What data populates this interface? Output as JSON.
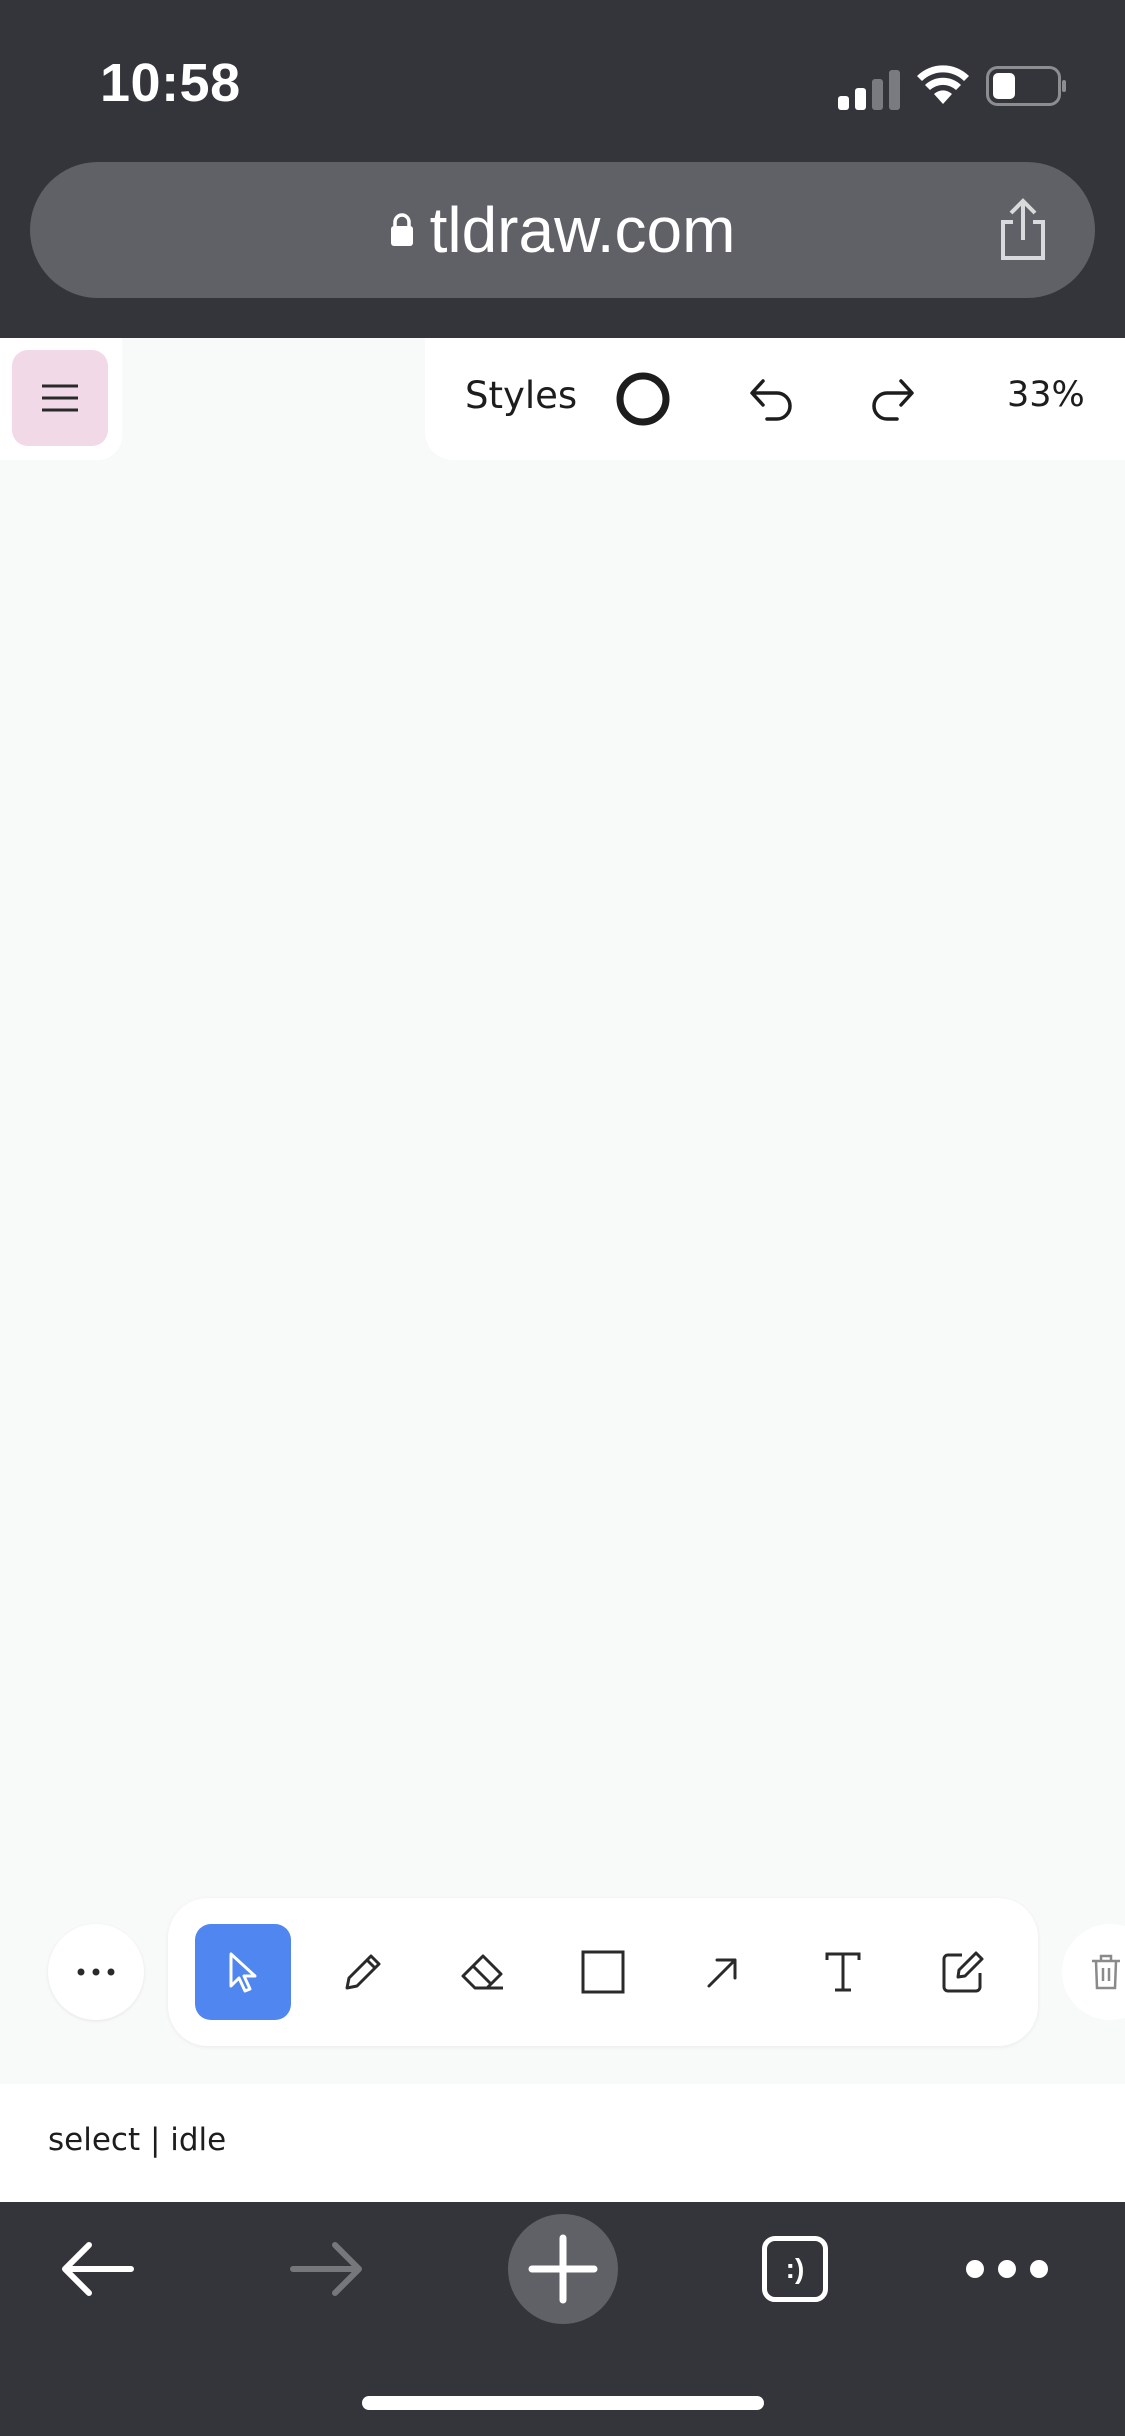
{
  "status_bar": {
    "time": "10:58",
    "icons": [
      "cellular-signal-icon",
      "wifi-icon",
      "battery-icon"
    ]
  },
  "url_bar": {
    "domain": "tldraw.com",
    "icons": [
      "lock-icon",
      "share-icon"
    ]
  },
  "app": {
    "menu_icon": "hamburger-menu-icon",
    "style_panel": {
      "styles_label": "Styles",
      "zoom": "33%",
      "icons": [
        "style-circle-icon",
        "undo-icon",
        "redo-icon"
      ]
    },
    "toolbar": {
      "more_icon": "more-horizontal-icon",
      "tools": [
        {
          "id": "select",
          "icon": "cursor-icon",
          "active": true
        },
        {
          "id": "draw",
          "icon": "pencil-icon",
          "active": false
        },
        {
          "id": "eraser",
          "icon": "eraser-icon",
          "active": false
        },
        {
          "id": "rectangle",
          "icon": "rectangle-icon",
          "active": false
        },
        {
          "id": "arrow",
          "icon": "arrow-icon",
          "active": false
        },
        {
          "id": "text",
          "icon": "text-icon",
          "active": false
        },
        {
          "id": "note",
          "icon": "note-edit-icon",
          "active": false
        }
      ],
      "delete_icon": "trash-icon"
    },
    "state_text": "select | idle"
  },
  "browser_bar": {
    "icons": [
      "back-arrow-icon",
      "forward-arrow-icon",
      "new-tab-plus-icon",
      "tabs-icon",
      "more-dots-icon"
    ],
    "tabs_glyph": ":)"
  },
  "colors": {
    "chrome_dark": "#34353a",
    "url_pill": "#5f6166",
    "canvas": "#f8f9f9",
    "active_tool": "#4f86f0",
    "menu_button": "#f2d9e8"
  }
}
